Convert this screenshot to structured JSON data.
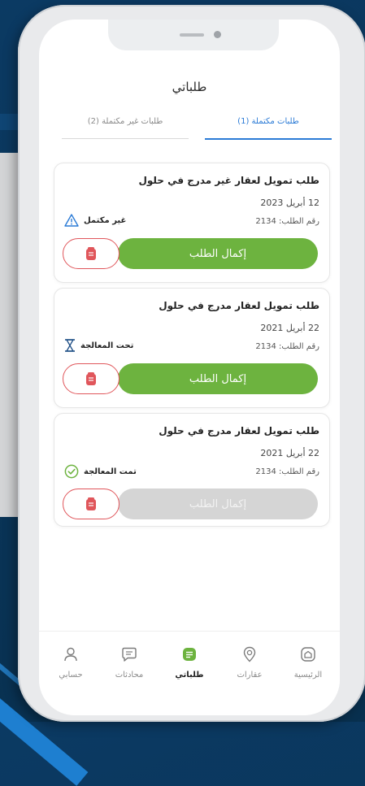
{
  "page_title": "طلباتي",
  "tabs": [
    {
      "label": "طلبات مكتملة (1)",
      "active": true
    },
    {
      "label": "طلبات غير مكتملة (2)",
      "active": false
    }
  ],
  "requests": [
    {
      "title": "طلب تمويل لعقار غير مدرج في حلول",
      "date": "12 أبريل 2023",
      "request_no": "رقم الطلب: 2134",
      "status": "غير مكتمل",
      "status_icon": "warning-icon",
      "action_label": "إكمال الطلب",
      "action_enabled": true
    },
    {
      "title": "طلب تمويل لعقار مدرج في حلول",
      "date": "22 أبريل 2021",
      "request_no": "رقم الطلب: 2134",
      "status": "تحت المعالجة",
      "status_icon": "hourglass-icon",
      "action_label": "إكمال الطلب",
      "action_enabled": true
    },
    {
      "title": "طلب تمويل لعقار مدرج في حلول",
      "date": "22 أبريل 2021",
      "request_no": "رقم الطلب: 2134",
      "status": "تمت المعالجة",
      "status_icon": "check-circle-icon",
      "action_label": "إكمال الطلب",
      "action_enabled": false
    }
  ],
  "bottom_nav": [
    {
      "label": "الرئيسية",
      "icon": "home-icon",
      "active": false
    },
    {
      "label": "عقارات",
      "icon": "location-pin-icon",
      "active": false
    },
    {
      "label": "طلباتي",
      "icon": "orders-icon",
      "active": true
    },
    {
      "label": "محادثات",
      "icon": "chat-icon",
      "active": false
    },
    {
      "label": "حسابي",
      "icon": "user-icon",
      "active": false
    }
  ],
  "colors": {
    "accent_green": "#6db33f",
    "accent_blue": "#2b7bd6",
    "danger_red": "#e0565b",
    "disabled_grey": "#d5d5d5",
    "background_navy": "#0a3559"
  }
}
